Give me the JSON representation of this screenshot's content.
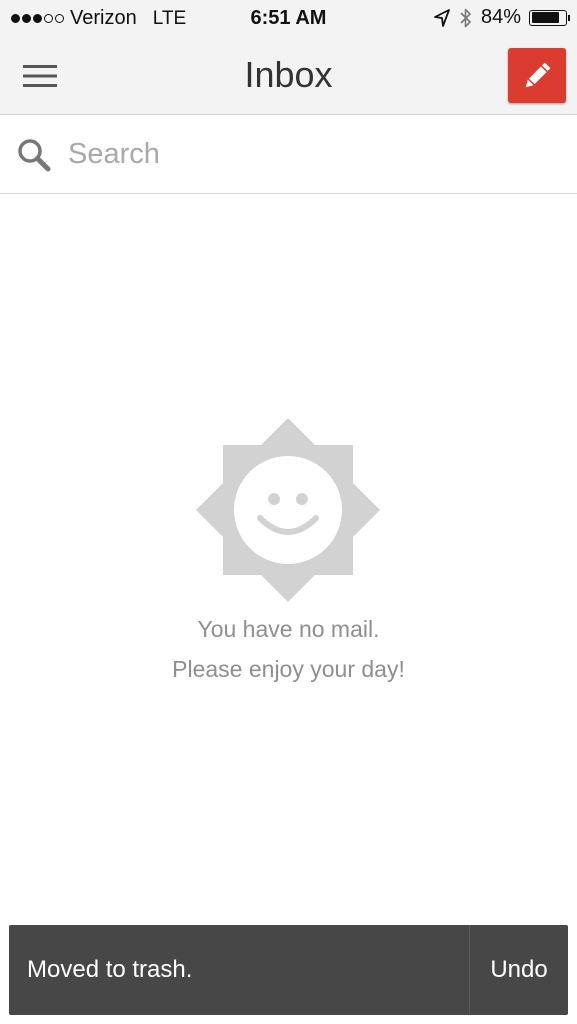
{
  "status_bar": {
    "carrier": "Verizon",
    "network": "LTE",
    "time": "6:51 AM",
    "battery_percent": "84%",
    "battery_level": 0.84,
    "signal_bars_filled": 3,
    "signal_bars_total": 5
  },
  "header": {
    "title": "Inbox",
    "menu_icon": "hamburger-menu-icon",
    "compose_icon": "pencil-icon",
    "compose_color": "#dc3b30"
  },
  "search": {
    "placeholder": "Search",
    "value": ""
  },
  "empty_state": {
    "icon": "smiling-sun-icon",
    "line1": "You have no mail.",
    "line2": "Please enjoy your day!"
  },
  "snackbar": {
    "message": "Moved to trash.",
    "action_label": "Undo",
    "background": "#474747"
  }
}
